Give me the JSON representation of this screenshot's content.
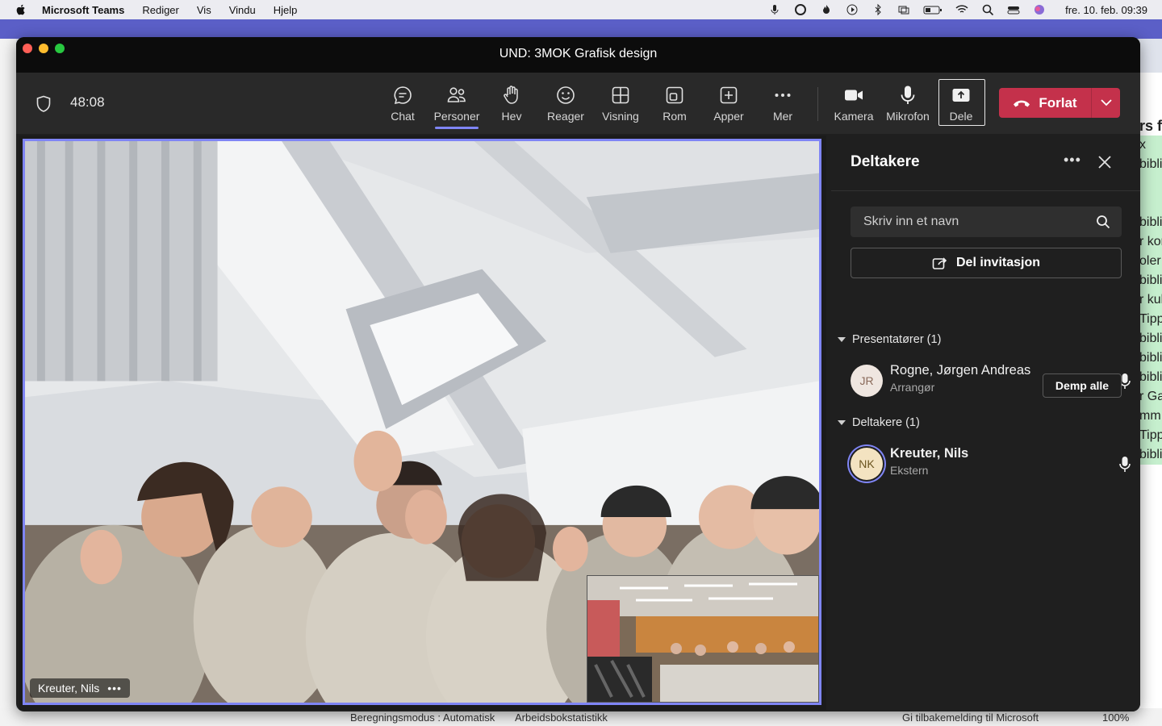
{
  "menubar": {
    "app_name": "Microsoft Teams",
    "items": [
      "Rediger",
      "Vis",
      "Vindu",
      "Hjelp"
    ],
    "clock": "fre. 10. feb.  09:39"
  },
  "window": {
    "title": "UND: 3MOK Grafisk design"
  },
  "toolbar": {
    "timer": "48:08",
    "buttons": [
      {
        "label": "Chat",
        "icon": "chat-icon"
      },
      {
        "label": "Personer",
        "icon": "people-icon",
        "active": true
      },
      {
        "label": "Hev",
        "icon": "raise-hand-icon"
      },
      {
        "label": "Reager",
        "icon": "smiley-icon"
      },
      {
        "label": "Visning",
        "icon": "grid-icon"
      },
      {
        "label": "Rom",
        "icon": "rooms-icon"
      },
      {
        "label": "Apper",
        "icon": "add-app-icon"
      },
      {
        "label": "Mer",
        "icon": "more-icon"
      },
      {
        "label": "Kamera",
        "icon": "camera-icon"
      },
      {
        "label": "Mikrofon",
        "icon": "microphone-icon"
      },
      {
        "label": "Dele",
        "icon": "share-icon"
      }
    ],
    "leave_label": "Forlat"
  },
  "stage": {
    "speaker_name": "Kreuter, Nils"
  },
  "panel": {
    "title": "Deltakere",
    "search_placeholder": "Skriv inn et navn",
    "invite_label": "Del invitasjon",
    "presenters_section": "Presentatører (1)",
    "attendees_section": "Deltakere (1)",
    "mute_all_label": "Demp alle",
    "presenters": [
      {
        "initials": "JR",
        "name": "Rogne, Jørgen Andreas",
        "role": "Arrangør"
      }
    ],
    "attendees": [
      {
        "initials": "NK",
        "name": "Kreuter, Nils",
        "role": "Ekstern"
      }
    ]
  },
  "background_app": {
    "status_mode": "Beregningsmodus : Automatisk",
    "status_stats": "Arbeidsbokstatistikk",
    "feedback": "Gi tilbakemelding til Microsoft",
    "zoom": "100%",
    "cells": [
      "rs f",
      "x",
      "bibli",
      "",
      "",
      "bibli",
      "r kor",
      "oler",
      "bibli",
      "r kul",
      "Tipp",
      "biblio",
      "bibli",
      "biblio",
      "r Ga",
      "mm",
      "Tipp",
      "biblio"
    ]
  },
  "colors": {
    "accent": "#7f85f5",
    "leave": "#c4314b",
    "toolbar_bg": "#292929",
    "panel_bg": "#1f1f1f"
  }
}
